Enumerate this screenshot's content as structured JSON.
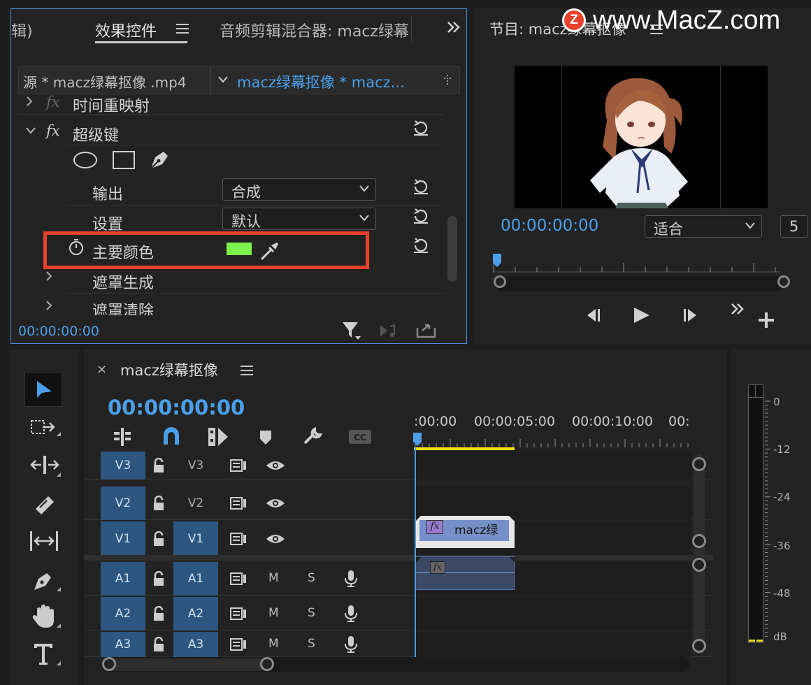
{
  "effect_controls": {
    "tabs": [
      "辑)",
      "效果控件",
      "音频剪辑混合器: macz绿幕"
    ],
    "source_label": "源 * macz绿幕抠像 .mp4",
    "sequence_label": "macz绿幕抠像 * macz...",
    "rows": {
      "time_remap": "时间重映射",
      "ultra_key": "超级键",
      "output_label": "输出",
      "output_value": "合成",
      "settings_label": "设置",
      "settings_value": "默认",
      "key_color_label": "主要颜色",
      "matte_gen": "遮罩生成",
      "matte_cleanup": "遮罩清除"
    },
    "key_color": "#7cf24a",
    "timecode": "00:00:00:00",
    "highlight_color": "#e8412c"
  },
  "program": {
    "title": "节目: macz绿幕抠像",
    "timecode": "00:00:00:00",
    "fit": "适合",
    "second_dd": "5"
  },
  "watermark": {
    "logo_letter": "Z",
    "text": "www.MacZ.com"
  },
  "timeline": {
    "title": "macz绿幕抠像",
    "timecode": "00:00:00:00",
    "ruler": [
      ":00:00",
      "00:00:05:00",
      "00:00:10:00",
      "00:"
    ],
    "tracks": [
      {
        "id": "V3",
        "name": "V3",
        "kind": "video"
      },
      {
        "id": "V2",
        "name": "V2",
        "kind": "video"
      },
      {
        "id": "V1",
        "name": "V1",
        "kind": "video"
      },
      {
        "id": "A1",
        "name": "A1",
        "kind": "audio"
      },
      {
        "id": "A2",
        "name": "A2",
        "kind": "audio"
      },
      {
        "id": "A3",
        "name": "A3",
        "kind": "audio"
      }
    ],
    "mute": "M",
    "solo": "S",
    "clip_name": "macz绿",
    "fx_badge": "fx"
  },
  "meter": {
    "labels": [
      "0",
      "-12",
      "-24",
      "-36",
      "-48",
      "dB"
    ]
  }
}
